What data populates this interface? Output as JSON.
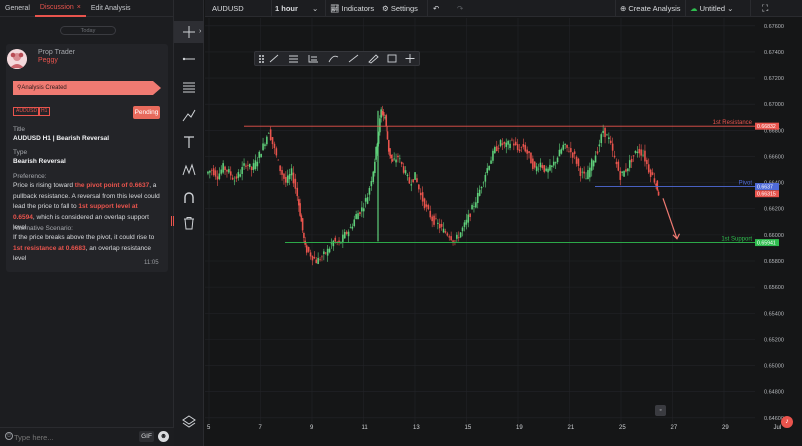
{
  "tabs": [
    {
      "label": "General"
    },
    {
      "label": "Discussion",
      "close": "×"
    },
    {
      "label": "Edit Analysis"
    }
  ],
  "feed": {
    "date_chip": "Today",
    "author_role": "Prop Trader",
    "author_name": "Peggy",
    "event": "Analysis Created",
    "symbol_badge": "AUDUSD",
    "timeframe_badge": "H1",
    "status": "Pending",
    "title_label": "Title",
    "title_value": "AUDUSD H1 | Bearish Reversal",
    "type_label": "Type",
    "type_value": "Bearish Reversal",
    "preference_label": "Preference:",
    "preference": {
      "t1": "Price is rising toward ",
      "h1": "the pivot point of 0.6637",
      "t2": ", a pullback resistance. A reversal from this level could lead the price to fall to ",
      "h2": "1st support level at 0.6594",
      "t3": ", which is considered an overlap support level."
    },
    "alternative_label": "Alternative Scenario:",
    "alternative": {
      "t1": "If the price breaks above the pivot, it could rise to ",
      "h1": "1st resistance at 0.6683",
      "t2": ", an overlap  resistance level"
    },
    "time": "11:05"
  },
  "chat": {
    "placeholder": "Type here...",
    "gif_label": "GIF"
  },
  "topbar": {
    "symbol": "AUDUSD",
    "timeframe": "1 hour",
    "indicators": "Indicators",
    "settings": "Settings",
    "create_analysis": "Create Analysis",
    "layout_name": "Untitled"
  },
  "tools": [
    "crosshair-icon",
    "horizontal-line-icon",
    "fib-lines-icon",
    "trend-brush-icon",
    "text-icon",
    "pattern-icon",
    "magnet-icon",
    "trash-icon"
  ],
  "chart_data": {
    "type": "candlestick",
    "symbol": "AUDUSD",
    "timeframe": "1 hour",
    "y_ticks": [
      "0.67600",
      "0.67400",
      "0.67200",
      "0.67000",
      "0.66800",
      "0.66600",
      "0.66400",
      "0.66200",
      "0.66000",
      "0.65800",
      "0.65600",
      "0.65400",
      "0.65200",
      "0.65000",
      "0.64800",
      "0.64600"
    ],
    "ylim": [
      0.6456,
      0.6766
    ],
    "x_ticks": [
      "5",
      "7",
      "9",
      "11",
      "13",
      "15",
      "19",
      "21",
      "25",
      "27",
      "29",
      "Jul"
    ],
    "levels": [
      {
        "name": "1st Resistance",
        "value": 0.66832,
        "label": "0.66832",
        "color": "#e9544d"
      },
      {
        "name": "Pivot",
        "value": 0.6637,
        "label": "0.6637",
        "color": "#4f6bd8"
      },
      {
        "name": "1st Support",
        "value": 0.65941,
        "label": "0.65941",
        "color": "#2fbd4f"
      }
    ],
    "last_price": {
      "label": "0.66315",
      "value": 0.66315,
      "color": "#e9544d"
    },
    "path": [
      [
        0,
        0.6647
      ],
      [
        3,
        0.665
      ],
      [
        6,
        0.6645
      ],
      [
        9,
        0.6652
      ],
      [
        12,
        0.6648
      ],
      [
        15,
        0.6642
      ],
      [
        18,
        0.6648
      ],
      [
        21,
        0.6655
      ],
      [
        24,
        0.665
      ],
      [
        27,
        0.6658
      ],
      [
        30,
        0.6668
      ],
      [
        33,
        0.668
      ],
      [
        36,
        0.6665
      ],
      [
        39,
        0.665
      ],
      [
        42,
        0.664
      ],
      [
        45,
        0.6648
      ],
      [
        48,
        0.663
      ],
      [
        50,
        0.661
      ],
      [
        52,
        0.659
      ],
      [
        55,
        0.6585
      ],
      [
        58,
        0.658
      ],
      [
        61,
        0.6583
      ],
      [
        64,
        0.6588
      ],
      [
        67,
        0.6595
      ],
      [
        70,
        0.6593
      ],
      [
        73,
        0.66
      ],
      [
        76,
        0.6605
      ],
      [
        79,
        0.6615
      ],
      [
        82,
        0.662
      ],
      [
        85,
        0.663
      ],
      [
        88,
        0.665
      ],
      [
        90,
        0.6672
      ],
      [
        92,
        0.6695
      ],
      [
        94,
        0.669
      ],
      [
        96,
        0.6665
      ],
      [
        98,
        0.6655
      ],
      [
        101,
        0.666
      ],
      [
        104,
        0.665
      ],
      [
        107,
        0.664
      ],
      [
        110,
        0.6645
      ],
      [
        113,
        0.663
      ],
      [
        116,
        0.662
      ],
      [
        119,
        0.6612
      ],
      [
        122,
        0.6608
      ],
      [
        125,
        0.6603
      ],
      [
        128,
        0.66
      ],
      [
        131,
        0.6595
      ],
      [
        134,
        0.6602
      ],
      [
        137,
        0.661
      ],
      [
        140,
        0.662
      ],
      [
        143,
        0.663
      ],
      [
        146,
        0.6643
      ],
      [
        149,
        0.6655
      ],
      [
        152,
        0.6665
      ],
      [
        155,
        0.667
      ],
      [
        158,
        0.6668
      ],
      [
        161,
        0.6672
      ],
      [
        164,
        0.6665
      ],
      [
        167,
        0.6668
      ],
      [
        170,
        0.666
      ],
      [
        173,
        0.665
      ],
      [
        176,
        0.6655
      ],
      [
        179,
        0.6648
      ],
      [
        182,
        0.6652
      ],
      [
        185,
        0.666
      ],
      [
        188,
        0.6668
      ],
      [
        191,
        0.6665
      ],
      [
        194,
        0.666
      ],
      [
        197,
        0.6648
      ],
      [
        200,
        0.6643
      ],
      [
        203,
        0.6655
      ],
      [
        206,
        0.6665
      ],
      [
        209,
        0.668
      ],
      [
        212,
        0.6673
      ],
      [
        215,
        0.6658
      ],
      [
        218,
        0.6645
      ],
      [
        221,
        0.665
      ],
      [
        224,
        0.6658
      ],
      [
        227,
        0.6665
      ],
      [
        230,
        0.6662
      ],
      [
        233,
        0.665
      ],
      [
        236,
        0.6642
      ],
      [
        238,
        0.6632
      ]
    ]
  }
}
